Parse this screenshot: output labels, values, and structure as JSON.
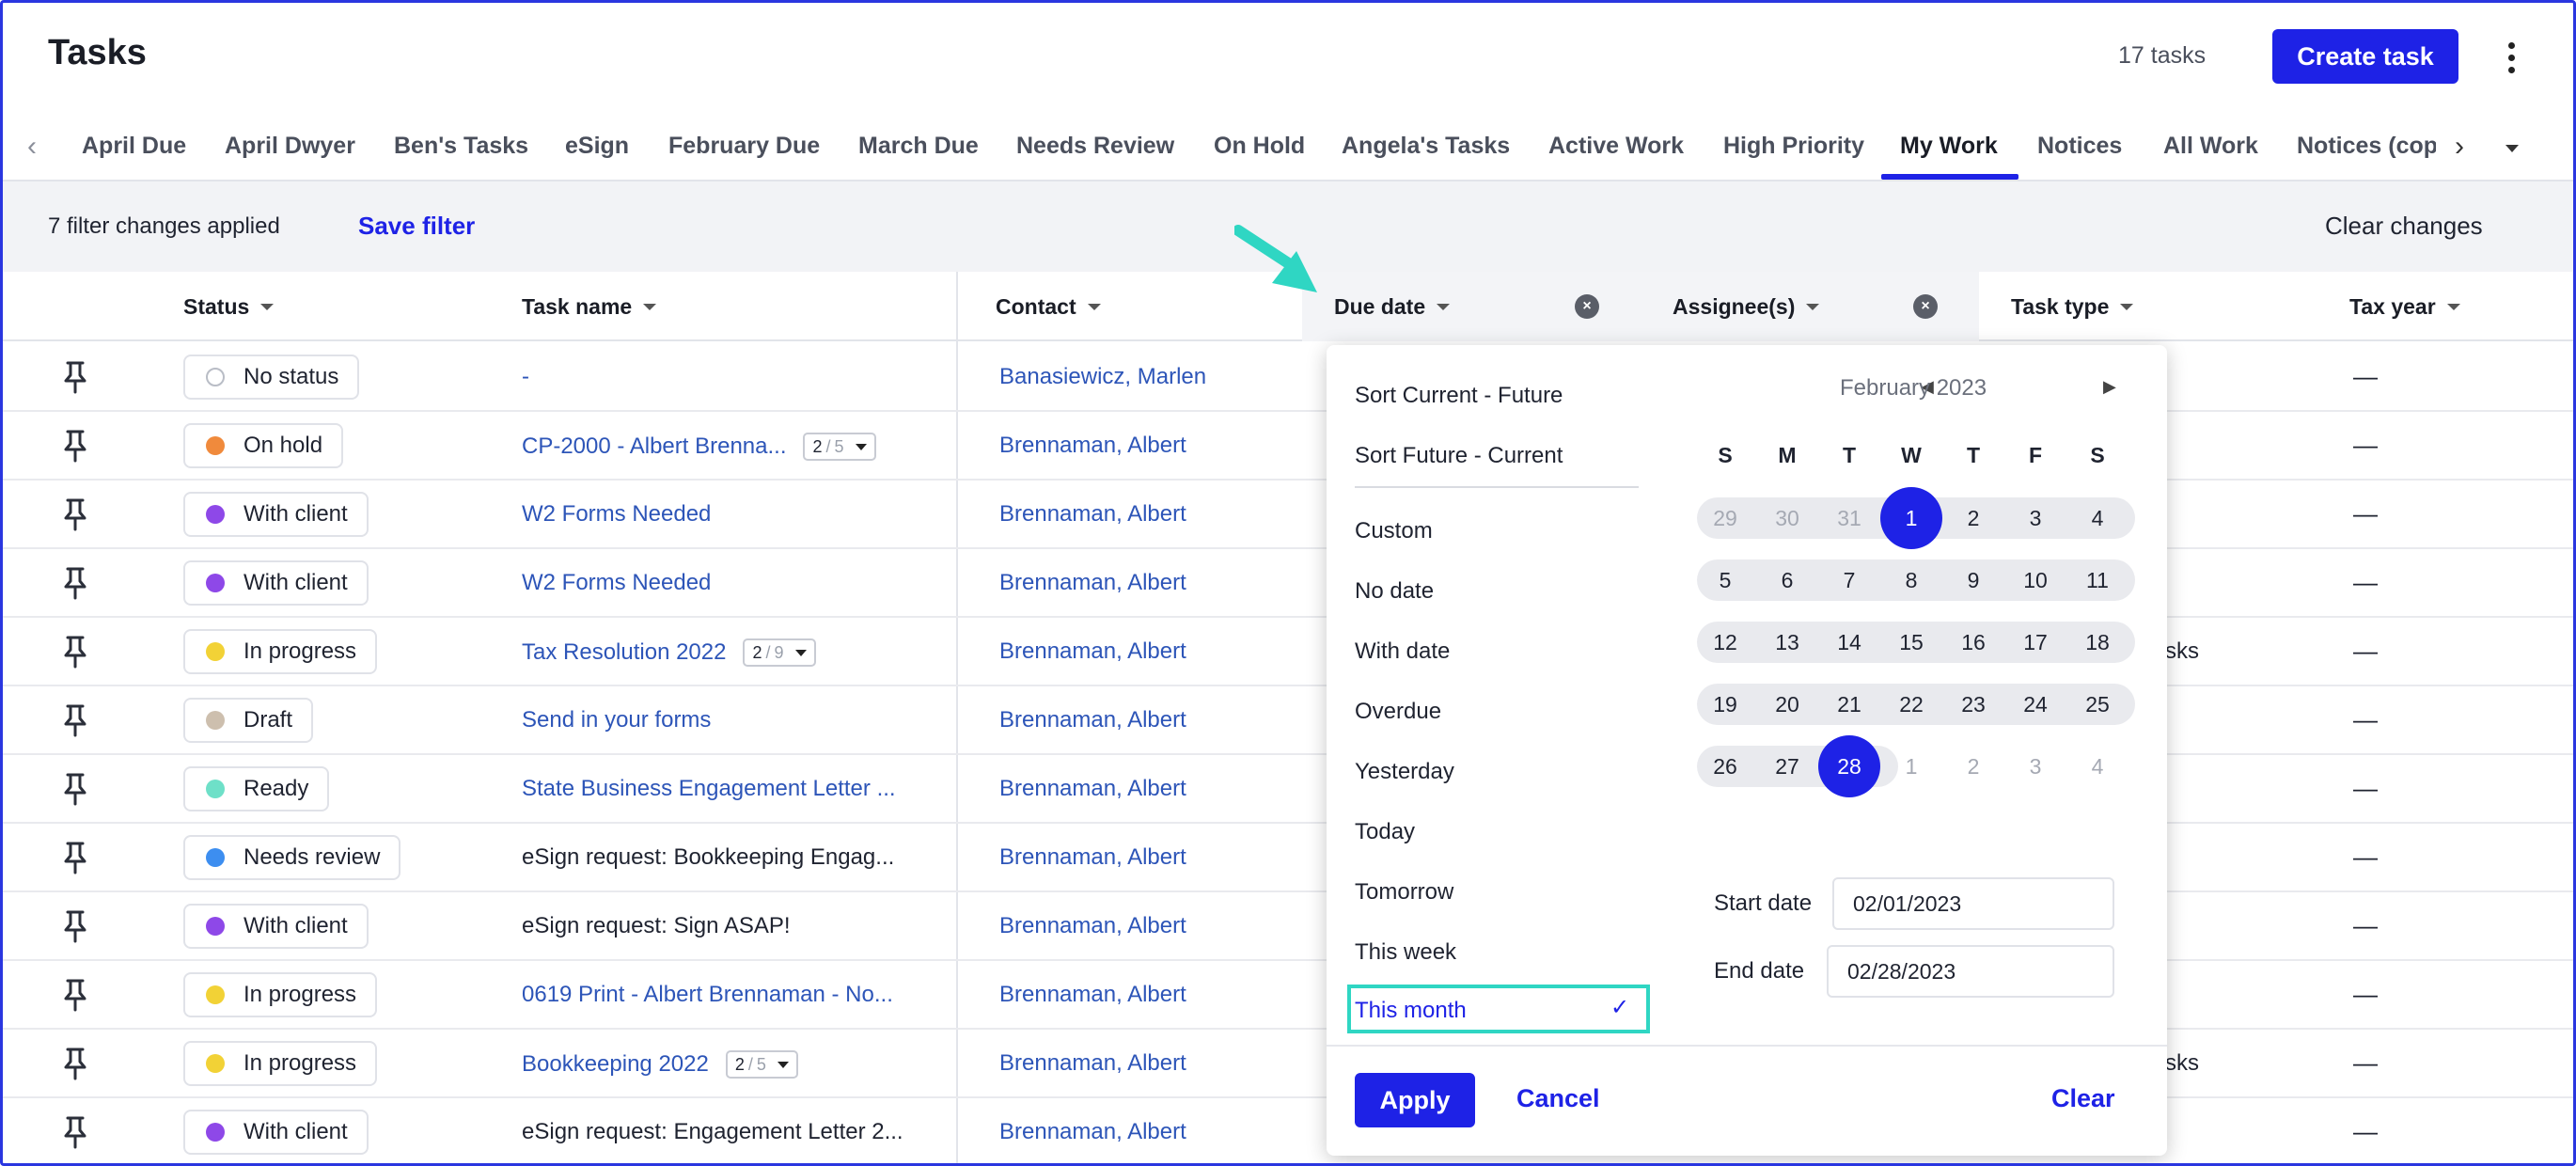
{
  "header": {
    "title": "Tasks",
    "task_count": "17 tasks",
    "create_label": "Create task"
  },
  "tabs": [
    {
      "label": "April Due"
    },
    {
      "label": "April Dwyer"
    },
    {
      "label": "Ben's Tasks"
    },
    {
      "label": "eSign"
    },
    {
      "label": "February Due"
    },
    {
      "label": "March Due"
    },
    {
      "label": "Needs Review"
    },
    {
      "label": "On Hold"
    },
    {
      "label": "Angela's Tasks"
    },
    {
      "label": "Active Work"
    },
    {
      "label": "High Priority"
    },
    {
      "label": "My Work",
      "active": true
    },
    {
      "label": "Notices"
    },
    {
      "label": "All Work"
    },
    {
      "label": "Notices (cop"
    }
  ],
  "filterbar": {
    "changes_text": "7 filter changes applied",
    "save_label": "Save filter",
    "clear_label": "Clear changes"
  },
  "columns": {
    "status": "Status",
    "task_name": "Task name",
    "contact": "Contact",
    "due_date": "Due date",
    "assignees": "Assignee(s)",
    "task_type": "Task type",
    "tax_year": "Tax year"
  },
  "rows": [
    {
      "status": "No status",
      "color": "#ffffff",
      "task": "-",
      "link": true,
      "counter": null,
      "contact": "Banasiewicz, Marlen",
      "type": "",
      "year": "—"
    },
    {
      "status": "On hold",
      "color": "#f08a3c",
      "task": "CP-2000 - Albert Brenna...",
      "link": true,
      "counter": {
        "done": "2",
        "total": "5"
      },
      "contact": "Brennaman, Albert",
      "type": "",
      "year": "—"
    },
    {
      "status": "With client",
      "color": "#8e48e8",
      "task": "W2 Forms Needed",
      "link": true,
      "counter": null,
      "contact": "Brennaman, Albert",
      "type": "",
      "year": "—"
    },
    {
      "status": "With client",
      "color": "#8e48e8",
      "task": "W2 Forms Needed",
      "link": true,
      "counter": null,
      "contact": "Brennaman, Albert",
      "type": "",
      "year": "—"
    },
    {
      "status": "In progress",
      "color": "#f2d236",
      "task": "Tax Resolution 2022",
      "link": true,
      "counter": {
        "done": "2",
        "total": "9"
      },
      "contact": "Brennaman, Albert",
      "type": "sks",
      "year": "—"
    },
    {
      "status": "Draft",
      "color": "#cdbfae",
      "task": "Send in your forms",
      "link": true,
      "counter": null,
      "contact": "Brennaman, Albert",
      "type": "",
      "year": "—"
    },
    {
      "status": "Ready",
      "color": "#6ee0c8",
      "task": "State Business Engagement Letter ...",
      "link": true,
      "counter": null,
      "contact": "Brennaman, Albert",
      "type": "",
      "year": "—"
    },
    {
      "status": "Needs review",
      "color": "#3d8ef0",
      "task": "eSign request: Bookkeeping Engag...",
      "link": false,
      "counter": null,
      "contact": "Brennaman, Albert",
      "type": "",
      "year": "—"
    },
    {
      "status": "With client",
      "color": "#8e48e8",
      "task": "eSign request: Sign ASAP!",
      "link": false,
      "counter": null,
      "contact": "Brennaman, Albert",
      "type": "",
      "year": "—"
    },
    {
      "status": "In progress",
      "color": "#f2d236",
      "task": "0619 Print - Albert Brennaman - No...",
      "link": true,
      "counter": null,
      "contact": "Brennaman, Albert",
      "type": "",
      "year": "—"
    },
    {
      "status": "In progress",
      "color": "#f2d236",
      "task": "Bookkeeping 2022",
      "link": true,
      "counter": {
        "done": "2",
        "total": "5"
      },
      "contact": "Brennaman, Albert",
      "type": "sks",
      "year": "—"
    },
    {
      "status": "With client",
      "color": "#8e48e8",
      "task": "eSign request: Engagement Letter 2...",
      "link": false,
      "counter": null,
      "contact": "Brennaman, Albert",
      "type": "",
      "year": "—"
    }
  ],
  "popup": {
    "options": [
      "Sort Current - Future",
      "Sort Future - Current",
      "Custom",
      "No date",
      "With date",
      "Overdue",
      "Yesterday",
      "Today",
      "Tomorrow",
      "This week"
    ],
    "selected_option": "This month",
    "check": "✓",
    "calendar": {
      "month_label": "February 2023",
      "dow": [
        "S",
        "M",
        "T",
        "W",
        "T",
        "F",
        "S"
      ],
      "weeks": [
        [
          "29",
          "30",
          "31",
          "1",
          "2",
          "3",
          "4"
        ],
        [
          "5",
          "6",
          "7",
          "8",
          "9",
          "10",
          "11"
        ],
        [
          "12",
          "13",
          "14",
          "15",
          "16",
          "17",
          "18"
        ],
        [
          "19",
          "20",
          "21",
          "22",
          "23",
          "24",
          "25"
        ],
        [
          "26",
          "27",
          "28",
          "1",
          "2",
          "3",
          "4"
        ]
      ]
    },
    "start_label": "Start date",
    "start_value": "02/01/2023",
    "end_label": "End date",
    "end_value": "02/28/2023",
    "apply_label": "Apply",
    "cancel_label": "Cancel",
    "clear_label": "Clear"
  },
  "colors": {
    "accent": "#1e22e6",
    "highlight": "#2fd6c3",
    "link": "#2d55b8"
  }
}
